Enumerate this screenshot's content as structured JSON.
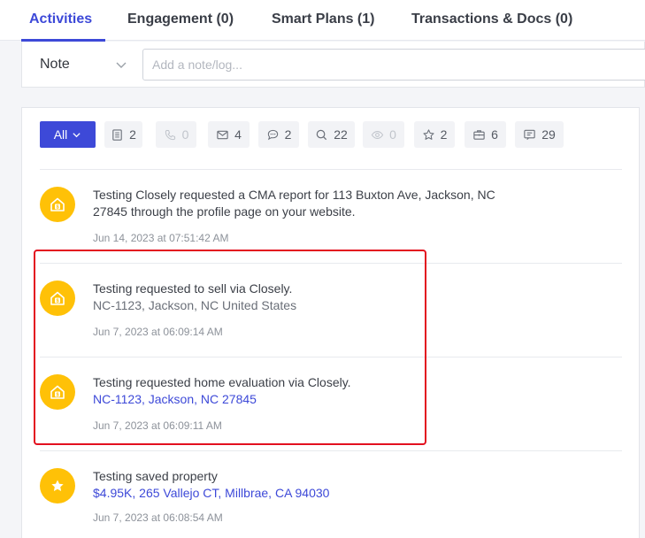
{
  "tabs": [
    {
      "label": "Activities"
    },
    {
      "label": "Engagement (0)"
    },
    {
      "label": "Smart Plans (1)"
    },
    {
      "label": "Transactions & Docs (0)"
    }
  ],
  "note": {
    "type": "Note",
    "placeholder": "Add a note/log..."
  },
  "filters": {
    "all_label": "All",
    "chips": [
      {
        "icon": "document-icon",
        "count": "2"
      },
      {
        "icon": "phone-icon",
        "count": "0"
      },
      {
        "icon": "mail-icon",
        "count": "4"
      },
      {
        "icon": "chat-icon",
        "count": "2"
      },
      {
        "icon": "search-icon",
        "count": "22"
      },
      {
        "icon": "eye-icon",
        "count": "0"
      },
      {
        "icon": "star-icon",
        "count": "2"
      },
      {
        "icon": "briefcase-icon",
        "count": "6"
      },
      {
        "icon": "message-icon",
        "count": "29"
      }
    ]
  },
  "activities": [
    {
      "icon": "home-dollar-icon",
      "line1": "Testing Closely requested a CMA report for 113 Buxton Ave, Jackson, NC",
      "line2": "27845 through the profile page on your website.",
      "time": "Jun 14, 2023 at 07:51:42 AM"
    },
    {
      "icon": "home-dollar-icon",
      "line1": "Testing requested to sell via Closely.",
      "line2": "NC-1123, Jackson, NC United States",
      "time": "Jun 7, 2023 at 06:09:14 AM"
    },
    {
      "icon": "home-dollar-icon",
      "line1": "Testing requested home evaluation via Closely.",
      "line2": "NC-1123, Jackson, NC 27845",
      "time": "Jun 7, 2023 at 06:09:11 AM"
    },
    {
      "icon": "star-icon",
      "line1": "Testing saved property",
      "line2": "$4.95K, 265 Vallejo CT, Millbrae, CA 94030",
      "time": "Jun 7, 2023 at 06:08:54 AM"
    }
  ],
  "colors": {
    "accent": "#3d49d8",
    "activity_icon_bg": "#ffc107",
    "highlight": "#e3101f"
  }
}
